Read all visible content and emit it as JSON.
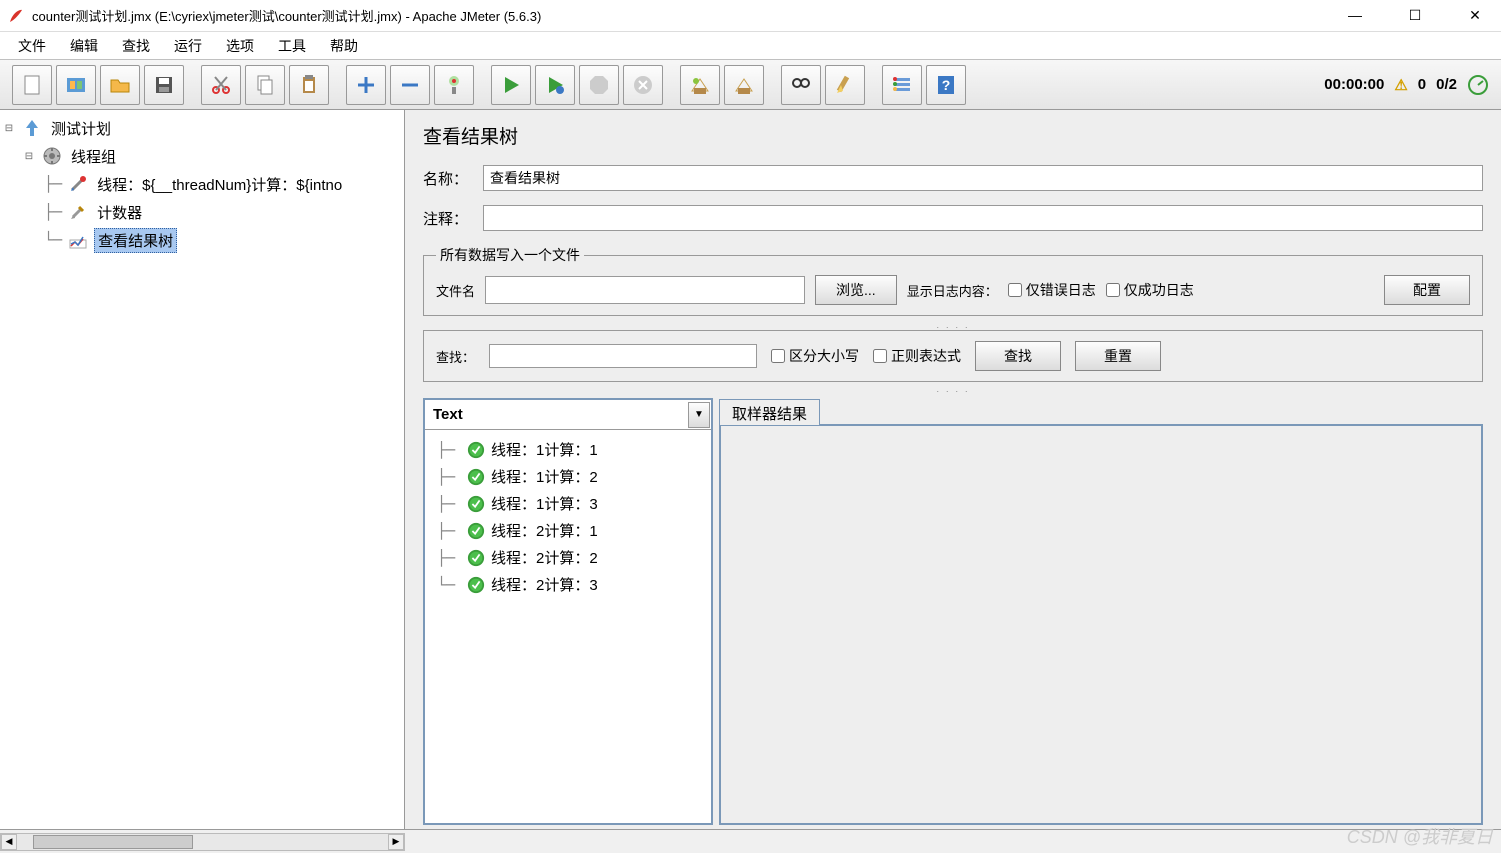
{
  "title": "counter测试计划.jmx (E:\\cyriex\\jmeter测试\\counter测试计划.jmx) - Apache JMeter (5.6.3)",
  "menu": {
    "file": "文件",
    "edit": "编辑",
    "search": "查找",
    "run": "运行",
    "options": "选项",
    "tools": "工具",
    "help": "帮助"
  },
  "status": {
    "time": "00:00:00",
    "warn_count": "0",
    "threads": "0/2"
  },
  "tree": {
    "root": "测试计划",
    "group": "线程组",
    "item1": "线程：${__threadNum}计算：${intno",
    "item2": "计数器",
    "item3": "查看结果树"
  },
  "panel": {
    "heading": "查看结果树",
    "name_label": "名称：",
    "name_value": "查看结果树",
    "comment_label": "注释：",
    "file_legend": "所有数据写入一个文件",
    "filename_label": "文件名",
    "browse": "浏览...",
    "log_content": "显示日志内容：",
    "only_err": "仅错误日志",
    "only_ok": "仅成功日志",
    "configure": "配置",
    "search_label": "查找：",
    "case": "区分大小写",
    "regex": "正则表达式",
    "search_btn": "查找",
    "reset_btn": "重置",
    "renderer": "Text",
    "tab_sampler": "取样器结果"
  },
  "results": [
    "线程：1计算：1",
    "线程：1计算：2",
    "线程：1计算：3",
    "线程：2计算：1",
    "线程：2计算：2",
    "线程：2计算：3"
  ],
  "watermark": "CSDN @我非夏日"
}
